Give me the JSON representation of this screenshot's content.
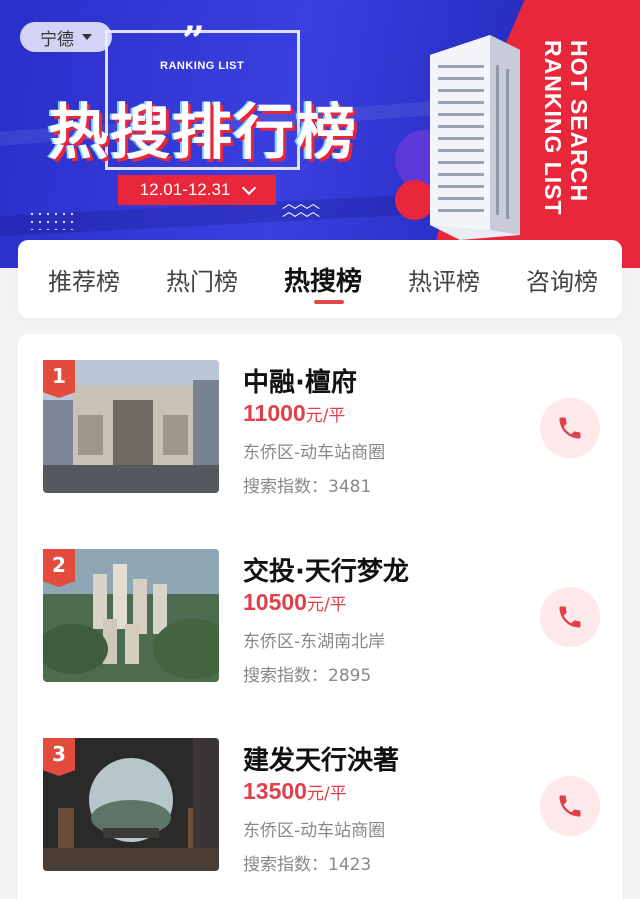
{
  "banner": {
    "quote_mark": "”",
    "subtitle": "RANKING LIST",
    "title": "热搜排行榜",
    "date_range": "12.01-12.31",
    "side_text": "HOT SEARCH RANKING LIST",
    "colors": {
      "blue": "#2a2fc9",
      "red": "#e8273b"
    }
  },
  "city_selector": {
    "label": "宁德"
  },
  "tabs": [
    {
      "label": "推荐榜",
      "active": false
    },
    {
      "label": "热门榜",
      "active": false
    },
    {
      "label": "热搜榜",
      "active": true
    },
    {
      "label": "热评榜",
      "active": false
    },
    {
      "label": "咨询榜",
      "active": false
    }
  ],
  "listings": [
    {
      "rank": "1",
      "name": "中融·檀府",
      "price": "11000",
      "unit": "元/平",
      "district": "东侨区-动车站商圈",
      "search_label": "搜索指数：",
      "search_value": "3481",
      "phone_icon": "phone-icon"
    },
    {
      "rank": "2",
      "name": "交投·天行梦龙",
      "price": "10500",
      "unit": "元/平",
      "district": "东侨区-东湖南北岸",
      "search_label": "搜索指数：",
      "search_value": "2895",
      "phone_icon": "phone-icon"
    },
    {
      "rank": "3",
      "name": "建发天行泱著",
      "price": "13500",
      "unit": "元/平",
      "district": "东侨区-动车站商圈",
      "search_label": "搜索指数：",
      "search_value": "1423",
      "phone_icon": "phone-icon"
    }
  ],
  "accent_color": "#e0404a"
}
